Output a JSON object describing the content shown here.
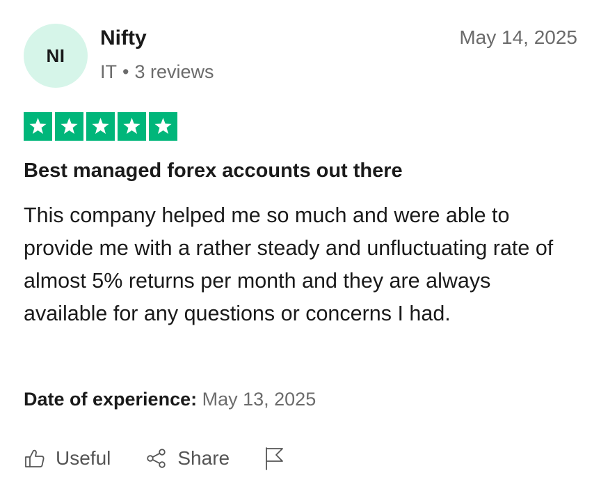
{
  "reviewer": {
    "initials": "NI",
    "name": "Nifty",
    "country": "IT",
    "separator": "•",
    "review_count": "3 reviews"
  },
  "review": {
    "date": "May 14, 2025",
    "rating": 5,
    "max_rating": 5,
    "star_color": "#00b67a",
    "title": "Best managed forex accounts out there",
    "body": "This company helped me so much and were able to provide me with a rather steady and unfluctuating rate of almost 5% returns per month and they are always available for any questions or concerns I had.",
    "experience_label": "Date of experience:",
    "experience_date": "May 13, 2025"
  },
  "actions": {
    "useful_label": "Useful",
    "share_label": "Share",
    "useful_icon": "thumbs-up-icon",
    "share_icon": "share-icon",
    "report_icon": "flag-icon"
  },
  "colors": {
    "avatar_bg": "#d6f5e9",
    "muted_text": "#6b6b6b",
    "primary_text": "#1a1a1a"
  }
}
